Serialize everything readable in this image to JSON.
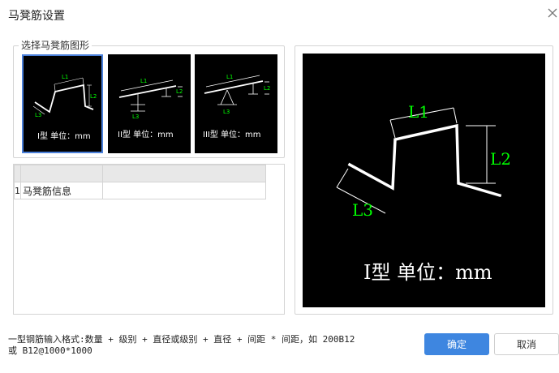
{
  "dialog": {
    "title": "马凳筋设置",
    "close_icon": "close-icon"
  },
  "shape_group": {
    "legend": "选择马凳筋图形",
    "thumbnails": [
      {
        "caption": "I型 单位：mm",
        "dims": [
          "L1",
          "L2",
          "L3"
        ],
        "selected": true
      },
      {
        "caption": "II型 单位：mm",
        "dims": [
          "L1",
          "L2",
          "L3"
        ],
        "selected": false
      },
      {
        "caption": "III型 单位：mm",
        "dims": [
          "L1",
          "L2",
          "L3"
        ],
        "selected": false
      }
    ]
  },
  "info_table": {
    "rows": [
      {
        "num": "1",
        "name": "马凳筋信息",
        "value": ""
      }
    ]
  },
  "preview": {
    "caption": "I型 单位：mm",
    "dims": [
      "L1",
      "L2",
      "L3"
    ]
  },
  "hint": {
    "line1": "一型钢筋输入格式:数量 + 级别 + 直径或级别 + 直径 + 间距 * 间距，如 200B12",
    "line2": "或 B12@1000*1000"
  },
  "buttons": {
    "ok": "确定",
    "cancel": "取消"
  },
  "colors": {
    "canvas_bg": "#000000",
    "shape_line": "#ffffff",
    "dim_text": "#00ff00",
    "accent": "#3e86e0",
    "selected_border": "#4a7fd9"
  }
}
